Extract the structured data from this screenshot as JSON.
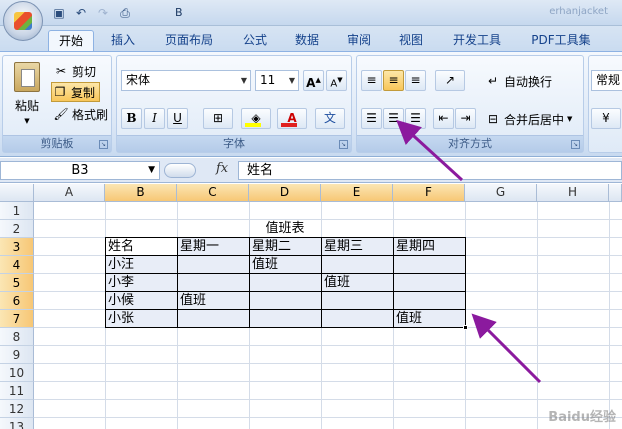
{
  "titlebar": {
    "title_prefix": "B",
    "title_right": "erhanjacket",
    "qat": [
      "save-icon",
      "undo-icon",
      "redo-icon",
      "print-preview-icon"
    ]
  },
  "tabs": [
    "开始",
    "插入",
    "页面布局",
    "公式",
    "数据",
    "审阅",
    "视图",
    "开发工具",
    "PDF工具集"
  ],
  "clipboard": {
    "paste": "粘贴",
    "cut": "剪切",
    "copy": "复制",
    "format_painter": "格式刷",
    "group_label": "剪贴板"
  },
  "font": {
    "name": "宋体",
    "size": "11",
    "bold": "B",
    "italic": "I",
    "underline": "U",
    "group_label": "字体",
    "font_color_hex": "#e02020",
    "fill_color_hex": "#ffff00"
  },
  "alignment": {
    "wrap_text": "自动换行",
    "merge_center": "合并后居中",
    "group_label": "对齐方式"
  },
  "number": {
    "format": "常规"
  },
  "formula_bar": {
    "name_box": "B3",
    "fx": "fx",
    "content": "姓名"
  },
  "sheet": {
    "columns": [
      "A",
      "B",
      "C",
      "D",
      "E",
      "F",
      "G",
      "H"
    ],
    "rows": [
      "1",
      "2",
      "3",
      "4",
      "5",
      "6",
      "7",
      "8",
      "9",
      "10",
      "11",
      "12",
      "13"
    ],
    "table_title": "值班表",
    "header": [
      "姓名",
      "星期一",
      "星期二",
      "星期三",
      "星期四"
    ],
    "data": [
      [
        "小汪",
        "",
        "值班",
        "",
        ""
      ],
      [
        "小李",
        "",
        "",
        "值班",
        ""
      ],
      [
        "小候",
        "值班",
        "",
        "",
        ""
      ],
      [
        "小张",
        "",
        "",
        "",
        "值班"
      ]
    ],
    "selected_columns": [
      "B",
      "C",
      "D",
      "E",
      "F"
    ],
    "selected_rows": [
      "3",
      "4",
      "5",
      "6",
      "7"
    ]
  },
  "annotation_color": "#8b1a9e",
  "watermark": "Baidu经验"
}
